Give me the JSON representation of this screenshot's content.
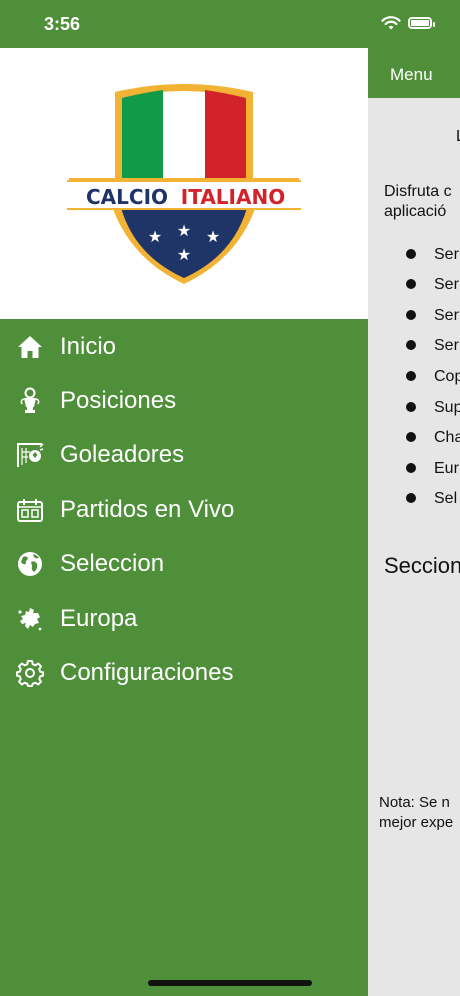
{
  "status_bar": {
    "time": "3:56"
  },
  "background_screen": {
    "nav_title": "Menu",
    "partial_heading": "L",
    "intro_lines": [
      "Disfruta c",
      "aplicació"
    ],
    "bullets": [
      "Ser",
      "Ser",
      "Ser",
      "Ser",
      "Cop",
      "Sup",
      "Cha",
      "Eur",
      "Sel"
    ],
    "section_title": "Seccion",
    "note_lines": [
      "Nota: Se n",
      "mejor expe"
    ]
  },
  "logo": {
    "word1": "CALCIO",
    "word2": "ITALIANO"
  },
  "menu": {
    "items": [
      {
        "label": "Inicio",
        "icon": "home-icon"
      },
      {
        "label": "Posiciones",
        "icon": "trophy-icon"
      },
      {
        "label": "Goleadores",
        "icon": "goal-net-icon"
      },
      {
        "label": "Partidos en Vivo",
        "icon": "scoreboard-icon"
      },
      {
        "label": "Seleccion",
        "icon": "globe-icon"
      },
      {
        "label": "Europa",
        "icon": "europe-map-icon"
      },
      {
        "label": "Configuraciones",
        "icon": "gear-icon"
      }
    ]
  },
  "colors": {
    "accent": "#4f8f3a",
    "panel_bg": "#e6e6e6",
    "italy_green": "#119a48",
    "italy_red": "#d2232a",
    "navy": "#1f3467",
    "gold": "#f2b233"
  }
}
